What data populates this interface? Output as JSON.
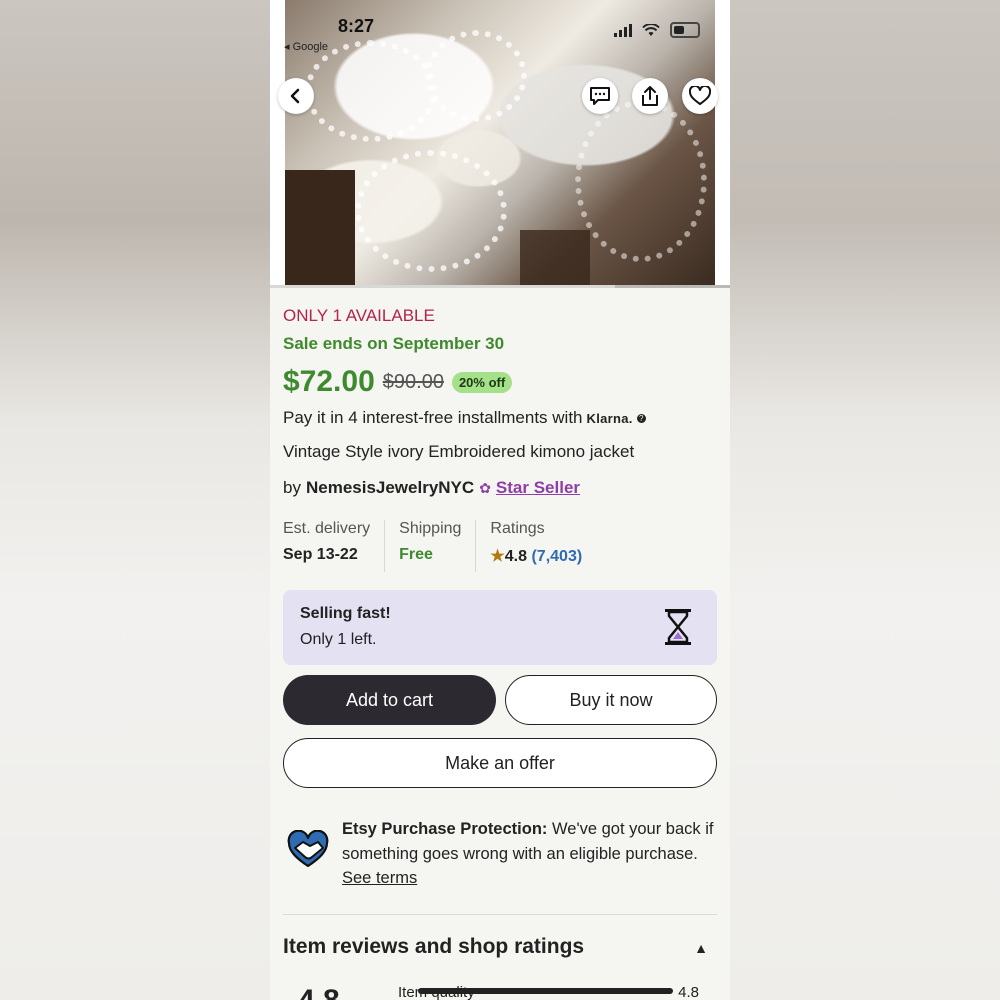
{
  "status_bar": {
    "time": "8:27",
    "back_app": "◂ Google"
  },
  "icons": {
    "back": "chevron-left-icon",
    "message": "message-icon",
    "share": "share-icon",
    "favorite": "heart-icon",
    "star_seller": "star-seller-badge-icon",
    "hourglass": "hourglass-icon",
    "protection": "handshake-heart-icon",
    "collapse": "chevron-up-icon"
  },
  "listing": {
    "availability": "ONLY 1 AVAILABLE",
    "sale_text": "Sale ends on September 30",
    "price": "$72.00",
    "original_price": "$90.00",
    "discount": "20% off",
    "installments_text": "Pay it in 4 interest-free installments with",
    "klarna": "Klarna.",
    "title": "Vintage Style ivory Embroidered kimono jacket",
    "by": "by",
    "seller": "NemesisJewelryNYC",
    "seller_badge": "Star Seller"
  },
  "info": {
    "delivery_label": "Est. delivery",
    "delivery_value": "Sep 13-22",
    "shipping_label": "Shipping",
    "shipping_value": "Free",
    "ratings_label": "Ratings",
    "rating_value": "4.8",
    "rating_count": "(7,403)"
  },
  "selling_fast": {
    "title": "Selling fast!",
    "subtitle": "Only 1 left."
  },
  "buttons": {
    "add_to_cart": "Add to cart",
    "buy_now": "Buy it now",
    "make_offer": "Make an offer"
  },
  "protection": {
    "title": "Etsy Purchase Protection:",
    "body": " We've got your back if something goes wrong with an eligible purchase. ",
    "link": "See terms"
  },
  "reviews": {
    "heading": "Item reviews and shop ratings",
    "overall": "4.8",
    "item_quality_label": "Item quality",
    "item_quality_value": "4.8"
  },
  "colors": {
    "availability": "#b3244a",
    "sale_green": "#3f8a2e",
    "discount_badge": "#a5e08a",
    "star_seller": "#8f3ea8",
    "rating_link": "#2f6bb3",
    "selling_fast_bg": "#e4e1f2",
    "cart_button": "#2c2930"
  }
}
